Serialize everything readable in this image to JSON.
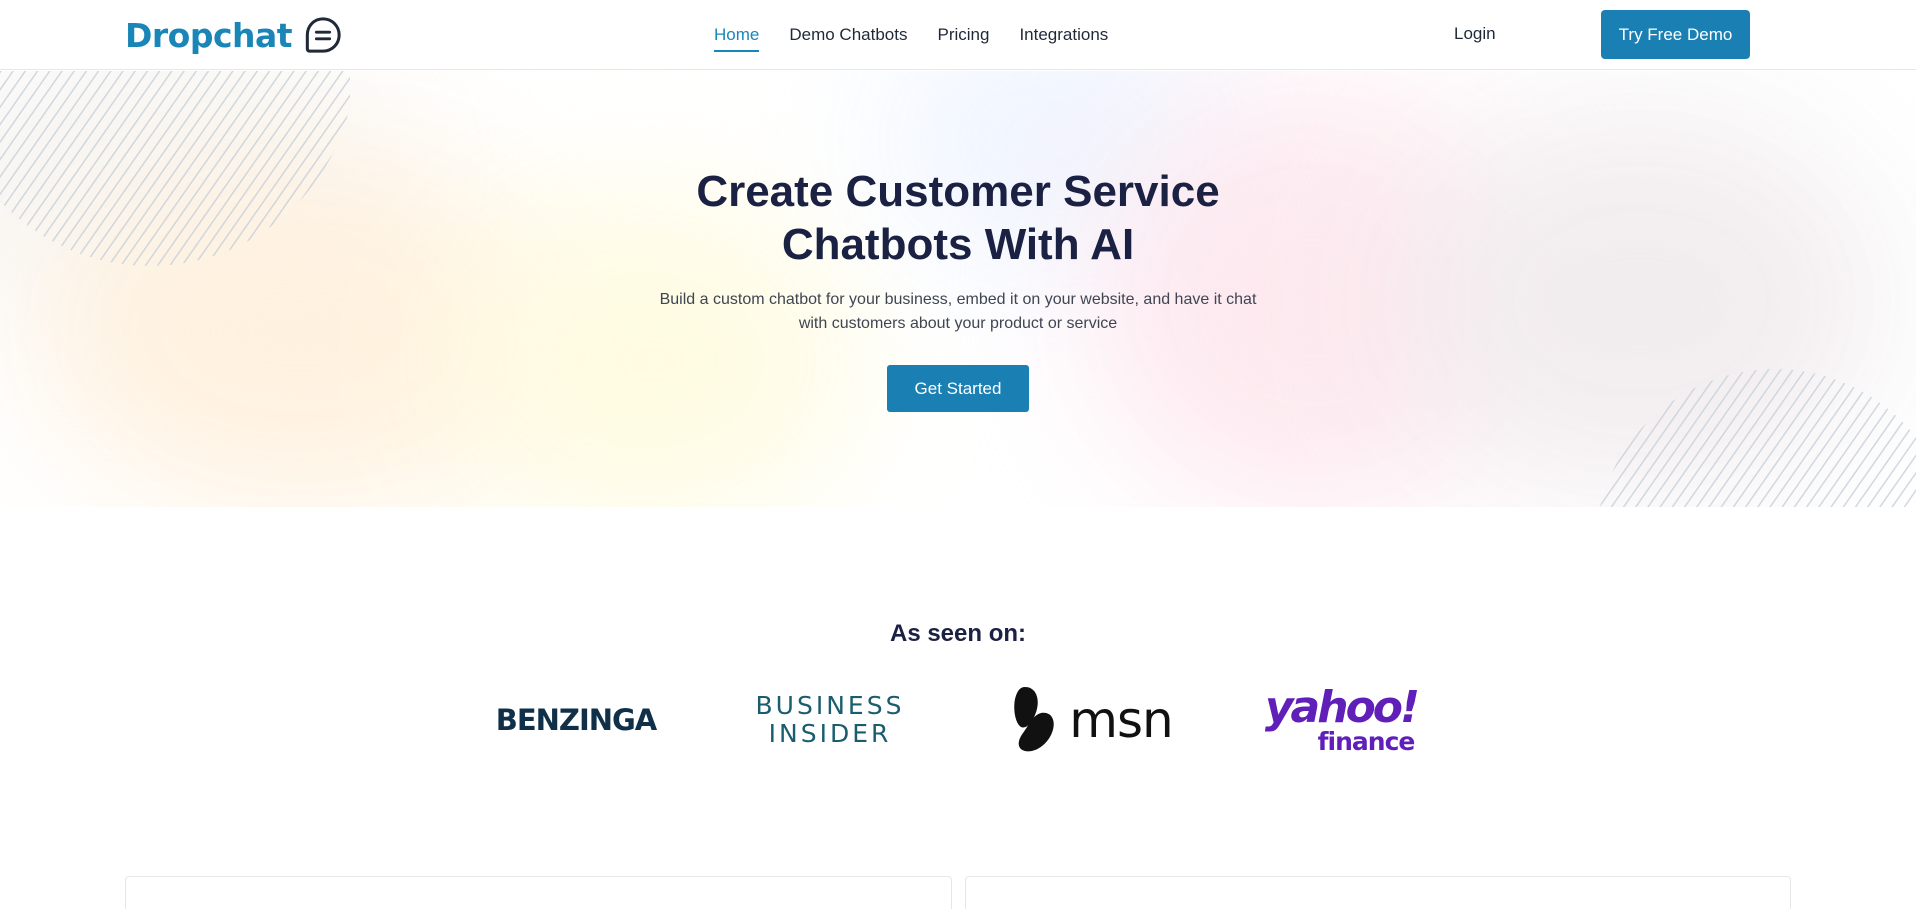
{
  "header": {
    "logo_text": "Dropchat",
    "logo_icon": "chat-bubble-icon",
    "nav": [
      {
        "label": "Home",
        "active": true
      },
      {
        "label": "Demo Chatbots",
        "active": false
      },
      {
        "label": "Pricing",
        "active": false
      },
      {
        "label": "Integrations",
        "active": false
      }
    ],
    "login_label": "Login",
    "cta_label": "Try Free Demo"
  },
  "hero": {
    "title_line1": "Create Customer Service",
    "title_line2": "Chatbots With AI",
    "subtitle_line1": "Build a custom chatbot for your business, embed it on your website, and have it chat",
    "subtitle_line2": "with customers about your product or service",
    "cta_label": "Get Started"
  },
  "press": {
    "title": "As seen on:",
    "logos": {
      "benzinga": "BENZINGA",
      "business_insider_line1": "BUSINESS",
      "business_insider_line2": "INSIDER",
      "msn": "msn",
      "yahoo_line1": "yahoo!",
      "yahoo_line2": "finance"
    }
  },
  "colors": {
    "brand": "#1a86b8",
    "button": "#1a80b4",
    "heading": "#1b2143",
    "yahoo_purple": "#5f1fb8"
  }
}
